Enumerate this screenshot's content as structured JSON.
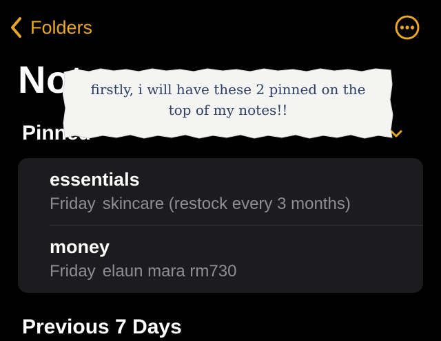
{
  "nav": {
    "back_label": "Folders",
    "more_icon": "ellipsis-circle-icon"
  },
  "page": {
    "title": "Notes"
  },
  "pinned": {
    "heading": "Pinned",
    "notes": [
      {
        "title": "essentials",
        "date": "Friday",
        "preview": "skincare (restock every 3 months)"
      },
      {
        "title": "money",
        "date": "Friday",
        "preview": "elaun mara rm730"
      }
    ]
  },
  "next_section": {
    "heading": "Previous 7 Days"
  },
  "overlay": {
    "line1": "firstly, i will have these 2 pinned on the",
    "line2": "top of my notes!!"
  },
  "colors": {
    "accent": "#e8a825",
    "background": "#000000",
    "card": "#1c1c1e",
    "secondary_text": "#8e8e93"
  }
}
